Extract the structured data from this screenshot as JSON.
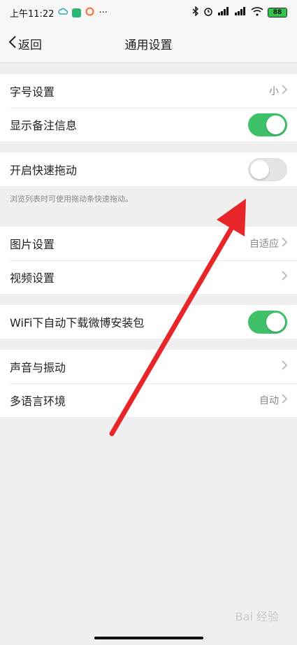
{
  "status": {
    "time": "上午11:22",
    "more": "···",
    "battery": "88"
  },
  "nav": {
    "back_label": "返回",
    "title": "通用设置"
  },
  "groups": [
    {
      "rows": [
        {
          "label": "字号设置",
          "value": "小",
          "type": "link"
        },
        {
          "label": "显示备注信息",
          "type": "toggle",
          "on": true
        }
      ]
    },
    {
      "rows": [
        {
          "label": "开启快速拖动",
          "type": "toggle",
          "on": false
        }
      ],
      "hint": "浏览列表时可使用拖动条快速拖动。"
    },
    {
      "rows": [
        {
          "label": "图片设置",
          "value": "自适应",
          "type": "link"
        },
        {
          "label": "视频设置",
          "value": "",
          "type": "link"
        }
      ]
    },
    {
      "rows": [
        {
          "label": "WiFi下自动下载微博安装包",
          "type": "toggle",
          "on": true
        }
      ]
    },
    {
      "rows": [
        {
          "label": "声音与振动",
          "value": "",
          "type": "link"
        },
        {
          "label": "多语言环境",
          "value": "自动",
          "type": "link"
        }
      ]
    }
  ],
  "watermark": "Bai 经验",
  "colors": {
    "toggle_on": "#3ec168",
    "arrow": "#e8262a"
  }
}
